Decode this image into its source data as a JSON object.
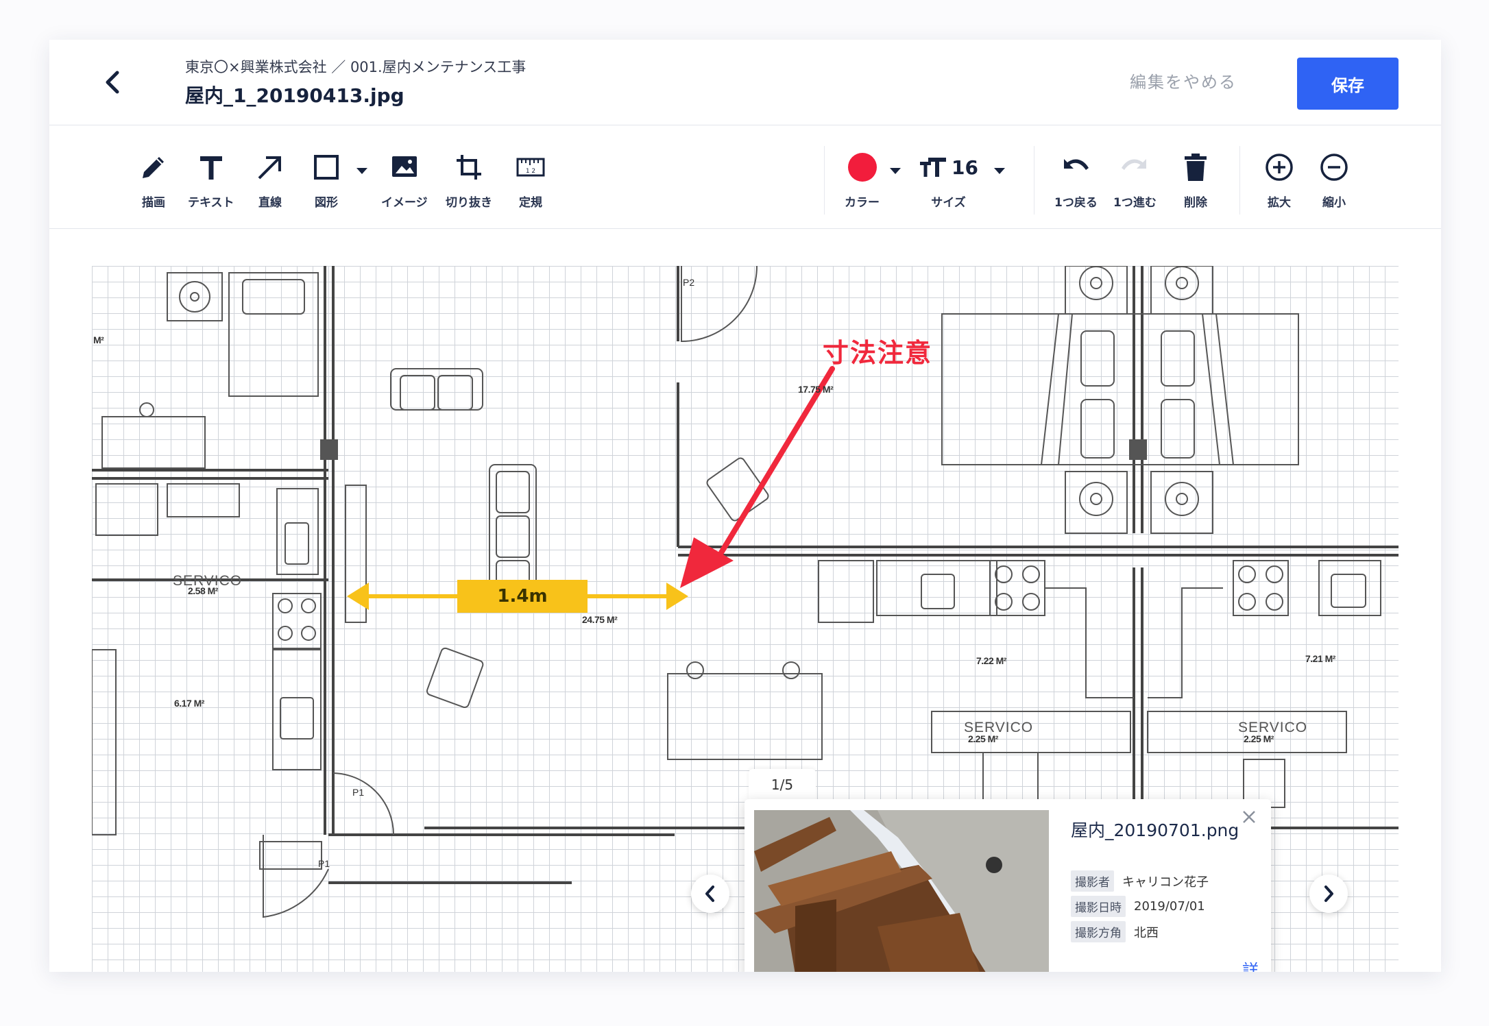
{
  "header": {
    "breadcrumb": "東京〇×興業株式会社 ／ 001.屋内メンテナンス工事",
    "filename": "屋内_1_20190413.jpg",
    "cancel_label": "編集をやめる",
    "save_label": "保存",
    "accent_color": "#2f63f4"
  },
  "toolbar": {
    "draw": "描画",
    "text": "テキスト",
    "line": "直線",
    "shape": "図形",
    "image": "イメージ",
    "crop": "切り抜き",
    "ruler": "定規",
    "ruler_icon_text": "1 2",
    "color": "カラー",
    "color_value": "#f21d3c",
    "size": "サイズ",
    "size_value": "16",
    "undo": "1つ戻る",
    "redo": "1つ進む",
    "delete": "削除",
    "zoom_in": "拡大",
    "zoom_out": "縮小"
  },
  "canvas": {
    "annotation_text": "寸法注意",
    "measure_label": "1.4m",
    "area_labels": [
      "24.75 M²",
      "17.75 M²",
      "2.58 M²",
      "6.17 M²",
      "7.22 M²",
      "7.21 M²",
      "2.25 M²",
      "2.25 M²",
      "M²"
    ],
    "servico_label": "SERVICO",
    "door_labels": [
      "P2",
      "P1",
      "P1"
    ]
  },
  "popup": {
    "page_indicator": "1/5",
    "photo_name": "屋内_20190701.png",
    "meta": [
      {
        "key": "撮影者",
        "value": "キャリコン花子"
      },
      {
        "key": "撮影日時",
        "value": "2019/07/01"
      },
      {
        "key": "撮影方角",
        "value": "北西"
      }
    ],
    "detail_link": "詳細"
  }
}
